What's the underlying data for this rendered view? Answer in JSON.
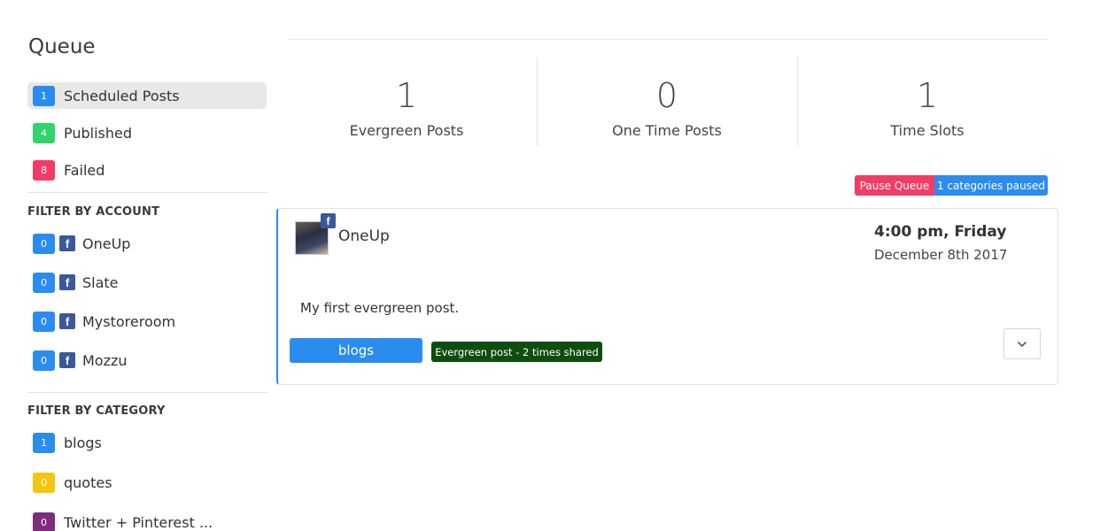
{
  "sidebar": {
    "title": "Queue",
    "nav": [
      {
        "count": "1",
        "label": "Scheduled Posts",
        "color": "#2b8cf0"
      },
      {
        "count": "4",
        "label": "Published",
        "color": "#2fd46b"
      },
      {
        "count": "8",
        "label": "Failed",
        "color": "#f53b65"
      }
    ],
    "account_heading": "FILTER BY ACCOUNT",
    "accounts": [
      {
        "count": "0",
        "icon": "facebook-icon",
        "label": "OneUp"
      },
      {
        "count": "0",
        "icon": "facebook-icon",
        "label": "Slate"
      },
      {
        "count": "0",
        "icon": "facebook-icon",
        "label": "Mystoreroom"
      },
      {
        "count": "0",
        "icon": "facebook-icon",
        "label": "Mozzu"
      }
    ],
    "category_heading": "FILTER BY CATEGORY",
    "categories": [
      {
        "count": "1",
        "label": "blogs",
        "color": "#2b8cf0"
      },
      {
        "count": "0",
        "label": "quotes",
        "color": "#f5c60e"
      },
      {
        "count": "0",
        "label": "Twitter + Pinterest ...",
        "color": "#7c2d7c"
      }
    ]
  },
  "stats": [
    {
      "value": "1",
      "label": "Evergreen Posts"
    },
    {
      "value": "0",
      "label": "One Time Posts"
    },
    {
      "value": "1",
      "label": "Time Slots"
    }
  ],
  "actions": {
    "pause_label": "Pause Queue",
    "paused_label": "1 categories paused"
  },
  "post": {
    "account": "OneUp",
    "time": "4:00 pm, Friday",
    "date": "December 8th 2017",
    "text": "My first evergreen post.",
    "category": "blogs",
    "evergreen_label": "Evergreen post - 2 times shared"
  },
  "colors": {
    "accent": "#2b8cf0",
    "danger": "#f53b65",
    "evergreen": "#0d4d0d",
    "facebook": "#3b5998"
  }
}
